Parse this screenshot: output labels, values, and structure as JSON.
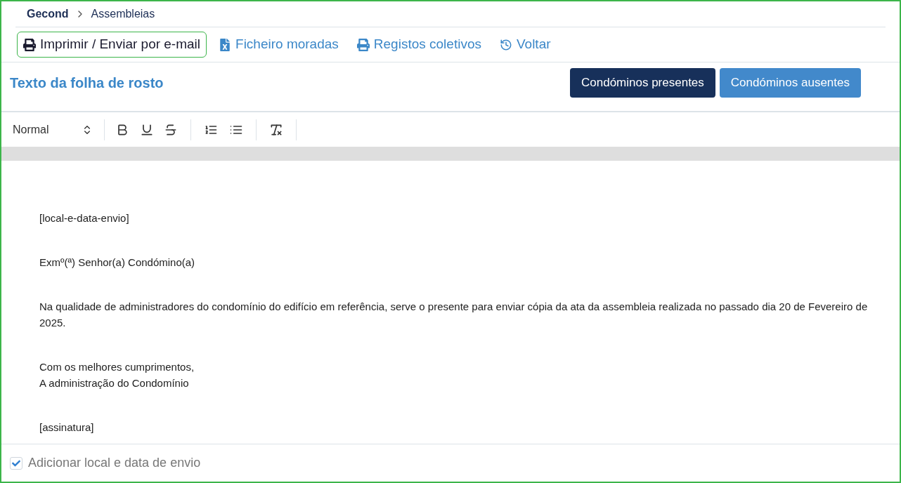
{
  "breadcrumb": [
    {
      "label": "Gecond",
      "current": false
    },
    {
      "label": "Assembleias",
      "current": true
    }
  ],
  "actions": [
    {
      "kind": "print",
      "label": "Imprimir / Enviar por e-mail",
      "selected": true
    },
    {
      "kind": "excel",
      "label": "Ficheiro moradas",
      "selected": false
    },
    {
      "kind": "print",
      "label": "Registos coletivos",
      "selected": false
    },
    {
      "kind": "history",
      "label": "Voltar",
      "selected": false
    }
  ],
  "section_title": "Texto da folha de rosto",
  "tabs": [
    {
      "label": "Condóminos presentes",
      "selected": true
    },
    {
      "label": "Condóminos ausentes",
      "selected": false
    }
  ],
  "editor": {
    "format": "Normal",
    "paragraphs": [
      {
        "lines": [
          "[local-e-data-envio]"
        ]
      },
      {
        "lines": [
          "Exmº(ª) Senhor(a) Condómino(a)"
        ]
      },
      {
        "lines": [
          "Na qualidade de administradores do condomínio do edifício em referência, serve o presente para enviar cópia da ata da assembleia realizada no passado dia 20 de Fevereiro de 2025."
        ]
      },
      {
        "lines": [
          "Com os melhores cumprimentos,",
          "A administração do Condomínio"
        ]
      },
      {
        "lines": [
          "[assinatura]"
        ]
      }
    ]
  },
  "checkbox": {
    "label": "Adicionar local e data de envio",
    "checked": true
  }
}
